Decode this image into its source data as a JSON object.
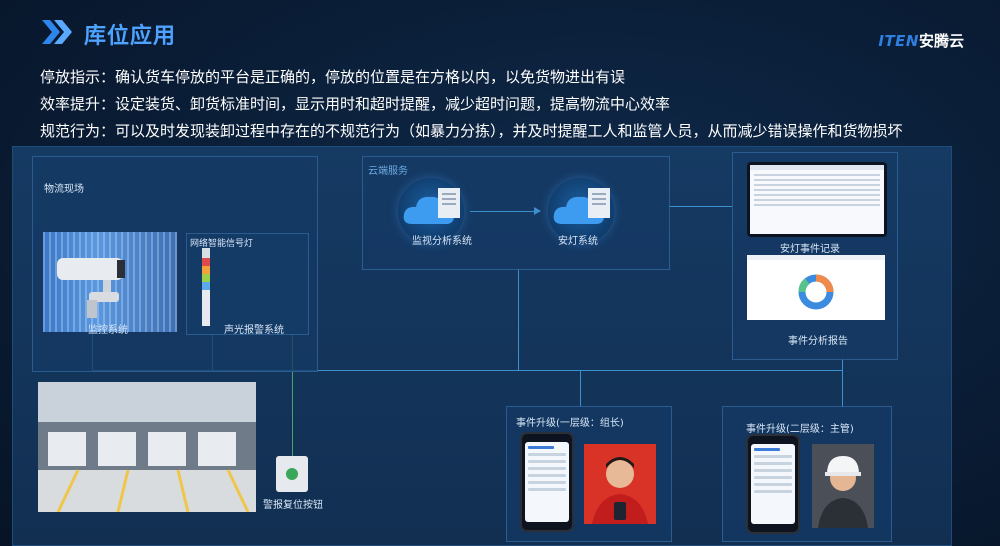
{
  "header": {
    "title": "库位应用",
    "logo_en": "ITEN",
    "logo_cn": "安腾云"
  },
  "intro": {
    "line1": "停放指示：确认货车停放的平台是正确的，停放的位置是在方格以内，以免货物进出有误",
    "line2": "效率提升：设定装货、卸货标准时间，显示用时和超时提醒，减少超时问题，提高物流中心效率",
    "line3": "规范行为：可以及时发现装卸过程中存在的不规范行为（如暴力分拣），并及时提醒工人和监管人员，从而减少错误操作和货物损坏"
  },
  "diagram": {
    "site_label": "物流现场",
    "camera_label": "监控系统",
    "signal_light_title": "网络智能信号灯",
    "signal_light_label": "声光报警系统",
    "reset_label": "警报复位按钮",
    "cloud_title": "云端服务",
    "analysis_label": "监视分析系统",
    "safety_label": "安灯系统",
    "record_label": "安灯事件记录",
    "report_label": "事件分析报告",
    "escalation1_label": "事件升级(一层级：组长)",
    "escalation2_label": "事件升级(二层级：主管)"
  },
  "colors": {
    "accent": "#4da3ff",
    "background": "#0a1d36",
    "panel": "#153a63",
    "connector": "#3e8fd0"
  }
}
